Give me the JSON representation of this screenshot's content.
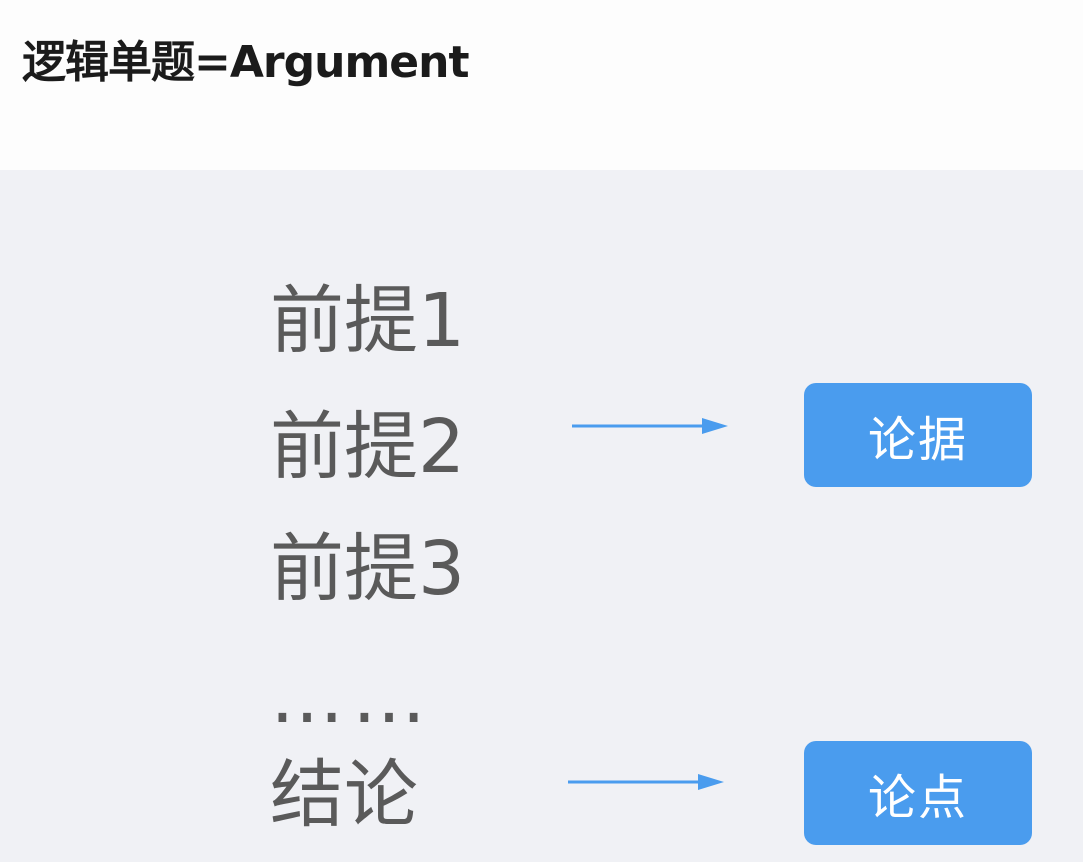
{
  "header": {
    "title": "逻辑单题=Argument"
  },
  "diagram": {
    "premises": [
      "前提1",
      "前提2",
      "前提3"
    ],
    "ellipsis": "……",
    "conclusion": "结论",
    "tags": {
      "evidence": "论据",
      "claim": "论点"
    },
    "colors": {
      "accent": "#4a9cee",
      "text": "#5a5a5a",
      "background": "#f0f1f5",
      "header_background": "#fdfdfd"
    }
  }
}
